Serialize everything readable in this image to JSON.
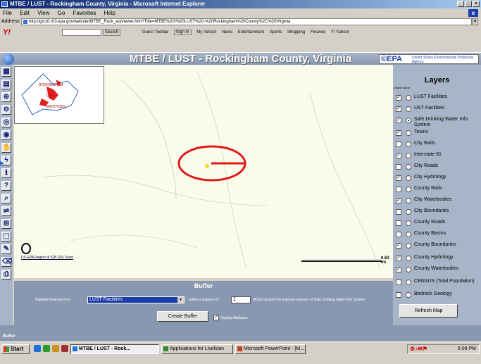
{
  "window": {
    "title": "MTBE / LUST - Rockingham County, Virginia - Microsoft Internet Explorer",
    "controls": [
      "_",
      "□",
      "×"
    ]
  },
  "menubar": {
    "items": [
      "File",
      "Edit",
      "View",
      "Go",
      "Favorites",
      "Help"
    ]
  },
  "address": {
    "label": "Address",
    "url": "http://gic10.r03.epa.gov/website/MTBE_Rock_eq/viewer.htm?Title=MTBE%20/%20LUST%20-%20Rockingham%20County%2C%20Virginia"
  },
  "yahoo_toolbar": {
    "logo": "Y!",
    "search_button": "Search",
    "guest_label": "Guest Toolbar",
    "signin_button": "Sign In",
    "items": [
      "My Yahoo!",
      "News",
      "Entertainment",
      "Sports",
      "Shopping",
      "Finance",
      "Y! Yahoo!"
    ]
  },
  "app": {
    "title": "MTBE / LUST - Rockingham County, Virginia",
    "epa_mark": "©EPA",
    "epa_sub": "United States Environmental Protection Agency"
  },
  "map": {
    "overview_labels": [
      "ROCKINGHAM",
      "CITY",
      "GROTTOES"
    ],
    "credit": "US EPA Region III IGB GIS Team",
    "scale_label": "0.63 mi"
  },
  "layers": {
    "title": "Layers",
    "header": "Visible Active",
    "items": [
      {
        "name": "LUST Facilities",
        "visible": true,
        "active": false
      },
      {
        "name": "UST Facilities",
        "visible": true,
        "active": false
      },
      {
        "name": "Safe Drinking Water Info System",
        "visible": true,
        "active": true
      },
      {
        "name": "Towns",
        "visible": true,
        "active": false
      },
      {
        "name": "City Rails",
        "visible": false,
        "active": false
      },
      {
        "name": "Interstate 81",
        "visible": true,
        "active": false
      },
      {
        "name": "City Roads",
        "visible": false,
        "active": false
      },
      {
        "name": "City Hydrology",
        "visible": true,
        "active": false
      },
      {
        "name": "County Rails",
        "visible": false,
        "active": false
      },
      {
        "name": "City Waterbodies",
        "visible": true,
        "active": false
      },
      {
        "name": "City Boundaries",
        "visible": false,
        "active": false
      },
      {
        "name": "County Roads",
        "visible": false,
        "active": false
      },
      {
        "name": "County Basins",
        "visible": false,
        "active": false
      },
      {
        "name": "County Boundaries",
        "visible": true,
        "active": false
      },
      {
        "name": "County Hydrology",
        "visible": true,
        "active": false
      },
      {
        "name": "County Waterbodies",
        "visible": true,
        "active": false
      },
      {
        "name": "CENSUS (Total Population)",
        "visible": false,
        "active": false
      },
      {
        "name": "Bedrock Geology",
        "visible": false,
        "active": false
      }
    ],
    "refresh_button": "Refresh Map"
  },
  "buffer": {
    "title": "Buffer",
    "highlight_label": "Highlight features from",
    "selected_layer": "LUST Facilities",
    "within_label": "within a distance of",
    "distance": "1",
    "miles_label": "MILES around the selected features of Safe Drinking Water Info System",
    "create_button": "Create Buffer",
    "display_attributes_label": "Display Attributes",
    "display_attributes_checked": true
  },
  "status": {
    "label": "Buffer"
  },
  "taskbar": {
    "start": "Start",
    "tasks": [
      "MTBE / LUST - Rock...",
      "Applications for Livelsian",
      "Microsoft PowerPoint - [M..."
    ],
    "clock": "6:09 PM"
  }
}
